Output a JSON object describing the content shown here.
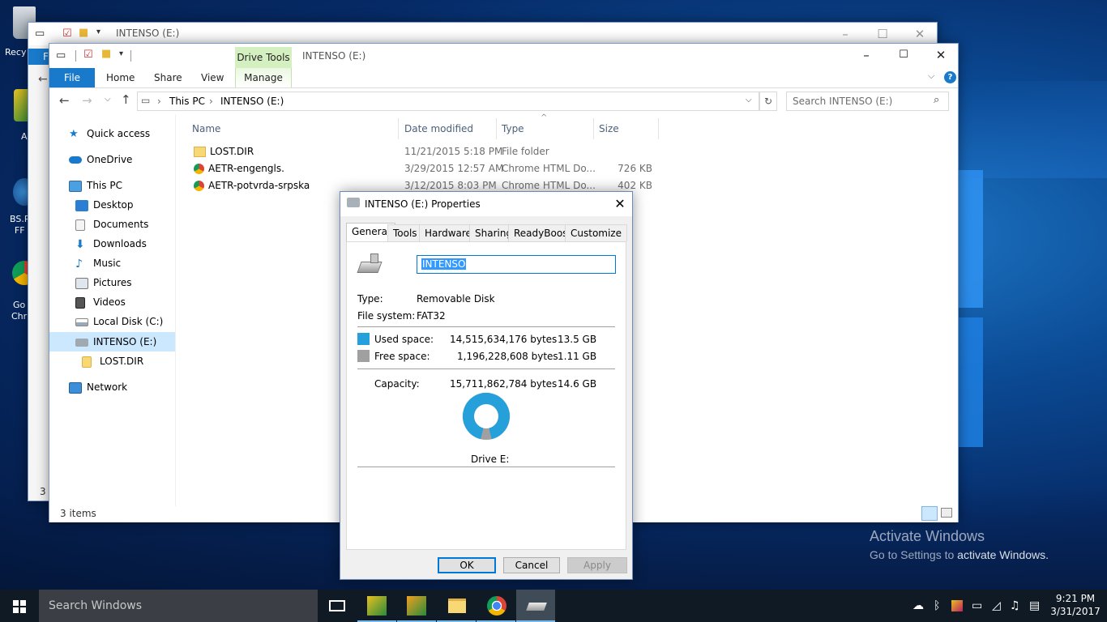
{
  "desktop": {
    "icons": [
      {
        "label": "Recy",
        "icon": "recycle-bin-icon"
      },
      {
        "label": "A",
        "icon": "app-icon"
      },
      {
        "label": "BS.P\nFF",
        "icon": "app-icon"
      },
      {
        "label": "Go\nChr",
        "icon": "chrome-icon"
      }
    ],
    "activate": {
      "line1": "Activate Windows",
      "line2_prefix": "Go to Settings to ",
      "line2_bold": "activate Windows."
    }
  },
  "back_window": {
    "title": "INTENSO (E:)",
    "ribbon_file": "F",
    "status": "3 i"
  },
  "explorer": {
    "title": "INTENSO (E:)",
    "context_tab": "Drive Tools",
    "tabs": [
      "File",
      "Home",
      "Share",
      "View",
      "Manage"
    ],
    "address": {
      "parts": [
        "This PC",
        "INTENSO (E:)"
      ]
    },
    "search_placeholder": "Search INTENSO (E:)",
    "nav": {
      "quick_access": "Quick access",
      "onedrive": "OneDrive",
      "this_pc": "This PC",
      "desktop": "Desktop",
      "documents": "Documents",
      "downloads": "Downloads",
      "music": "Music",
      "pictures": "Pictures",
      "videos": "Videos",
      "local_disk": "Local Disk (C:)",
      "intenso": "INTENSO (E:)",
      "lost_dir": "LOST.DIR",
      "network": "Network"
    },
    "columns": {
      "name": "Name",
      "date": "Date modified",
      "type": "Type",
      "size": "Size"
    },
    "files": [
      {
        "name": "LOST.DIR",
        "date": "11/21/2015 5:18 PM",
        "type": "File folder",
        "size": "",
        "icon": "folder-icon"
      },
      {
        "name": "AETR-engengls.",
        "date": "3/29/2015 12:57 AM",
        "type": "Chrome HTML Do...",
        "size": "726 KB",
        "icon": "chrome-icon"
      },
      {
        "name": "AETR-potvrda-srpska",
        "date": "3/12/2015 8:03 PM",
        "type": "Chrome HTML Do...",
        "size": "402 KB",
        "icon": "chrome-icon"
      }
    ],
    "status": "3 items"
  },
  "dialog": {
    "title": "INTENSO (E:) Properties",
    "tabs": [
      "General",
      "Tools",
      "Hardware",
      "Sharing",
      "ReadyBoost",
      "Customize"
    ],
    "label_value": "INTENSO",
    "type_label": "Type:",
    "type_value": "Removable Disk",
    "fs_label": "File system:",
    "fs_value": "FAT32",
    "used_label": "Used space:",
    "used_bytes": "14,515,634,176 bytes",
    "used_gb": "13.5 GB",
    "free_label": "Free space:",
    "free_bytes": "1,196,228,608 bytes",
    "free_gb": "1.11 GB",
    "cap_label": "Capacity:",
    "cap_bytes": "15,711,862,784 bytes",
    "cap_gb": "14.6 GB",
    "drive_label": "Drive E:",
    "used_fraction": 0.924,
    "used_color": "#26a0da",
    "free_color": "#a0a0a0",
    "buttons": {
      "ok": "OK",
      "cancel": "Cancel",
      "apply": "Apply"
    }
  },
  "taskbar": {
    "search": "Search Windows",
    "time": "9:21 PM",
    "date": "3/31/2017"
  }
}
